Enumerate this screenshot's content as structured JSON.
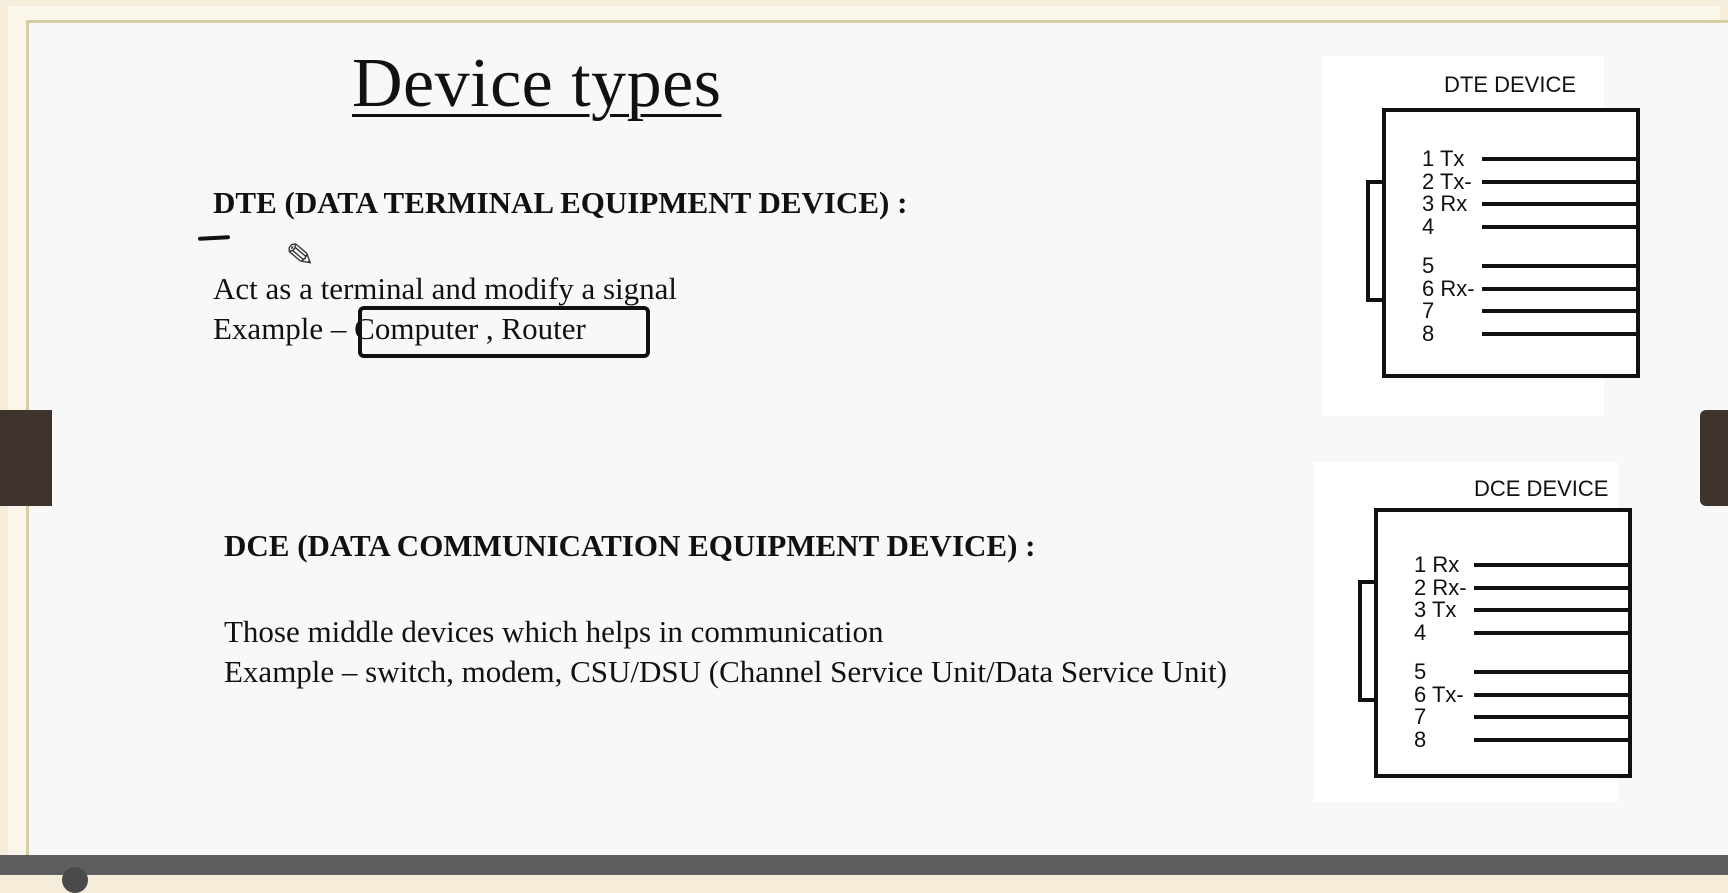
{
  "title": "Device types",
  "dte": {
    "heading": "DTE (DATA TERMINAL EQUIPMENT DEVICE) :",
    "description": "Act as a terminal and modify a signal",
    "example": "Example – Computer , Router"
  },
  "dce": {
    "heading": "DCE (DATA COMMUNICATION EQUIPMENT DEVICE) :",
    "description": "Those middle devices which helps in communication",
    "example": "Example – switch, modem, CSU/DSU (Channel Service Unit/Data Service Unit)"
  },
  "dte_diagram": {
    "label": "DTE DEVICE",
    "pins": [
      "1 Tx",
      "2 Tx-",
      "3 Rx",
      "4",
      "5",
      "6 Rx-",
      "7",
      "8"
    ]
  },
  "dce_diagram": {
    "label": "DCE DEVICE",
    "pins": [
      "1 Rx",
      "2 Rx-",
      "3 Tx",
      "4",
      "5",
      "6 Tx-",
      "7",
      "8"
    ]
  },
  "icons": {
    "annotation_tool": "pencil-icon"
  }
}
